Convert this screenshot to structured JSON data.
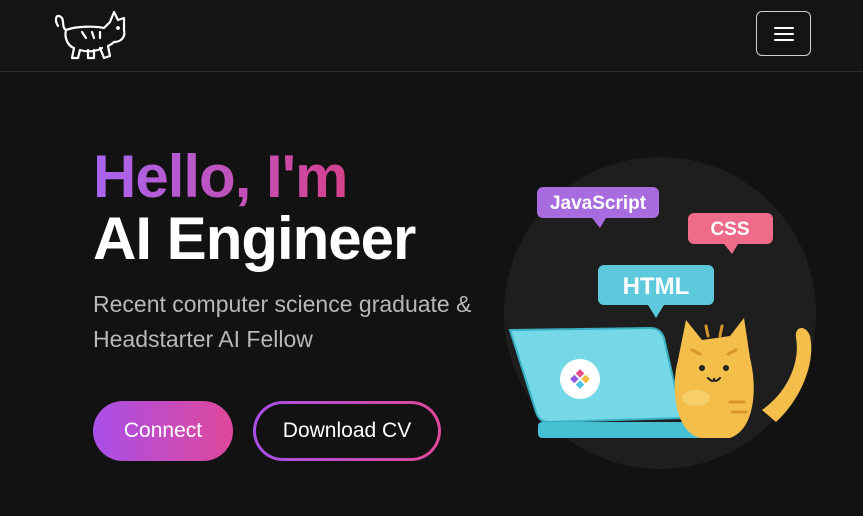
{
  "navbar": {
    "logo_icon": "cat-logo-icon",
    "menu_icon": "hamburger-menu-icon"
  },
  "hero": {
    "greeting": "Hello, I'm",
    "role": "AI Engineer",
    "subtitle": "Recent computer science graduate & Headstarter AI Fellow",
    "buttons": {
      "connect": "Connect",
      "download_cv": "Download CV"
    }
  },
  "illustration": {
    "tags": {
      "javascript": "JavaScript",
      "css": "CSS",
      "html": "HTML"
    },
    "icons": [
      "laptop-icon",
      "cat-icon"
    ]
  },
  "colors": {
    "background": "#121212",
    "gradient_start": "#a866f0",
    "gradient_end": "#d5418f",
    "tag_purple": "#a86be0",
    "tag_pink": "#ee6b8a",
    "tag_cyan": "#5ec9dc",
    "cat_orange": "#f3bf4a"
  }
}
